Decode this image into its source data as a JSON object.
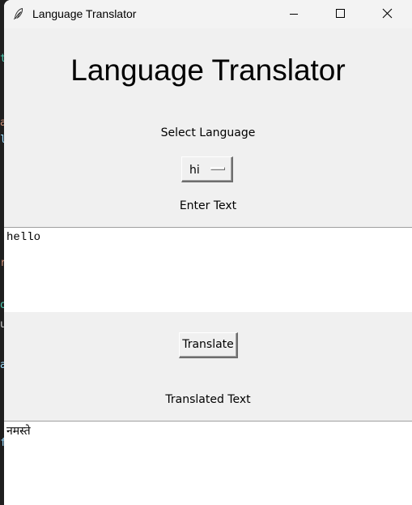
{
  "window": {
    "title": "Language Translator",
    "controls": {
      "minimize": "minimize-icon",
      "maximize": "maximize-icon",
      "close": "close-icon"
    },
    "app_icon": "feather-icon"
  },
  "main": {
    "heading": "Language Translator",
    "select_language_label": "Select Language",
    "language_selected": "hi",
    "enter_text_label": "Enter Text",
    "input_text": "hello",
    "translate_button": "Translate",
    "translated_text_label": "Translated Text",
    "output_text": "नमस्ते"
  },
  "colors": {
    "window_bg": "#f0f0f0",
    "textbox_bg": "#ffffff",
    "text": "#000000"
  }
}
